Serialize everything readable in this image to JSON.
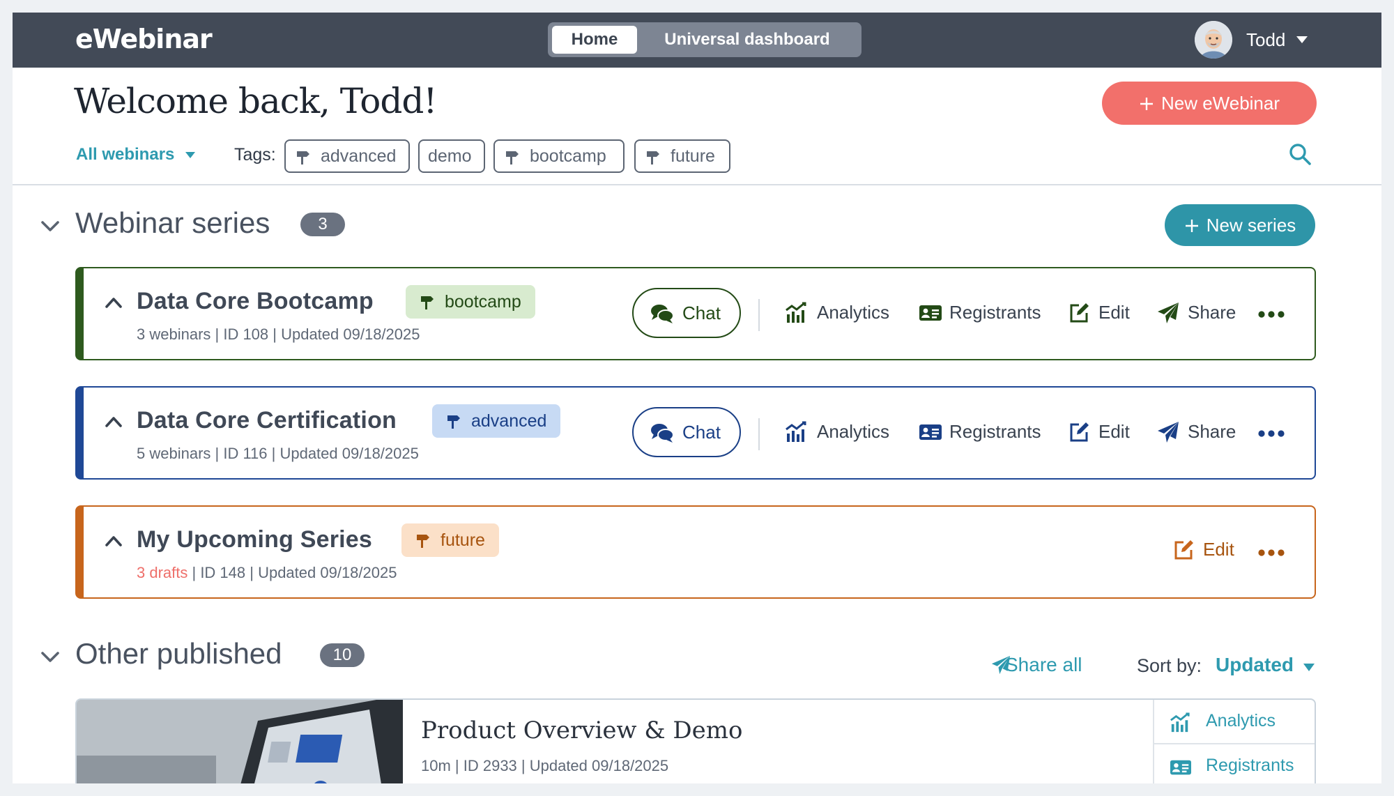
{
  "app": {
    "logo": "eWebinar"
  },
  "topbar": {
    "tabs": [
      {
        "label": "Home",
        "active": true
      },
      {
        "label": "Universal dashboard",
        "active": false
      }
    ],
    "user": {
      "name": "Todd"
    }
  },
  "header": {
    "welcome": "Welcome back, Todd!",
    "new_button": "New eWebinar",
    "filter": "All webinars",
    "tags_label": "Tags:",
    "tags": [
      "advanced",
      "demo",
      "bootcamp",
      "future"
    ]
  },
  "series_section": {
    "title": "Webinar series",
    "count": "3",
    "new_button": "New series",
    "cards": [
      {
        "title": "Data Core Bootcamp",
        "tag": "bootcamp",
        "count_text": "3 webinars",
        "meta_rest": " | ID 108 | Updated 09/18/2025",
        "color": "#2e5a1e",
        "tag_bg": "#d8ebcf",
        "tag_fg": "#234a16",
        "actions": {
          "chat": "Chat",
          "analytics": "Analytics",
          "registrants": "Registrants",
          "edit": "Edit",
          "share": "Share"
        }
      },
      {
        "title": "Data Core Certification",
        "tag": "advanced",
        "count_text": "5 webinars",
        "meta_rest": " | ID 116 | Updated 09/18/2025",
        "color": "#1f4896",
        "tag_bg": "#c7daf4",
        "tag_fg": "#1a3f86",
        "actions": {
          "chat": "Chat",
          "analytics": "Analytics",
          "registrants": "Registrants",
          "edit": "Edit",
          "share": "Share"
        }
      },
      {
        "title": "My Upcoming Series",
        "tag": "future",
        "count_text": "3 drafts",
        "meta_rest": " | ID 148 | Updated 09/18/2025",
        "color": "#c7651c",
        "tag_bg": "#fbe0c8",
        "tag_fg": "#a7540f",
        "actions": {
          "edit": "Edit"
        }
      }
    ]
  },
  "published_section": {
    "title": "Other published",
    "count": "10",
    "share_all": "Share all",
    "sort_label": "Sort by:",
    "sort_value": "Updated",
    "items": [
      {
        "title": "Product Overview & Demo",
        "meta": "10m  |  ID 2933  |  Updated 09/18/2025",
        "actions": {
          "analytics": "Analytics",
          "registrants": "Registrants"
        }
      }
    ]
  },
  "colors": {
    "accent": "#2e9aaf",
    "primary_button": "#f2706b",
    "topbar": "#424a57"
  }
}
